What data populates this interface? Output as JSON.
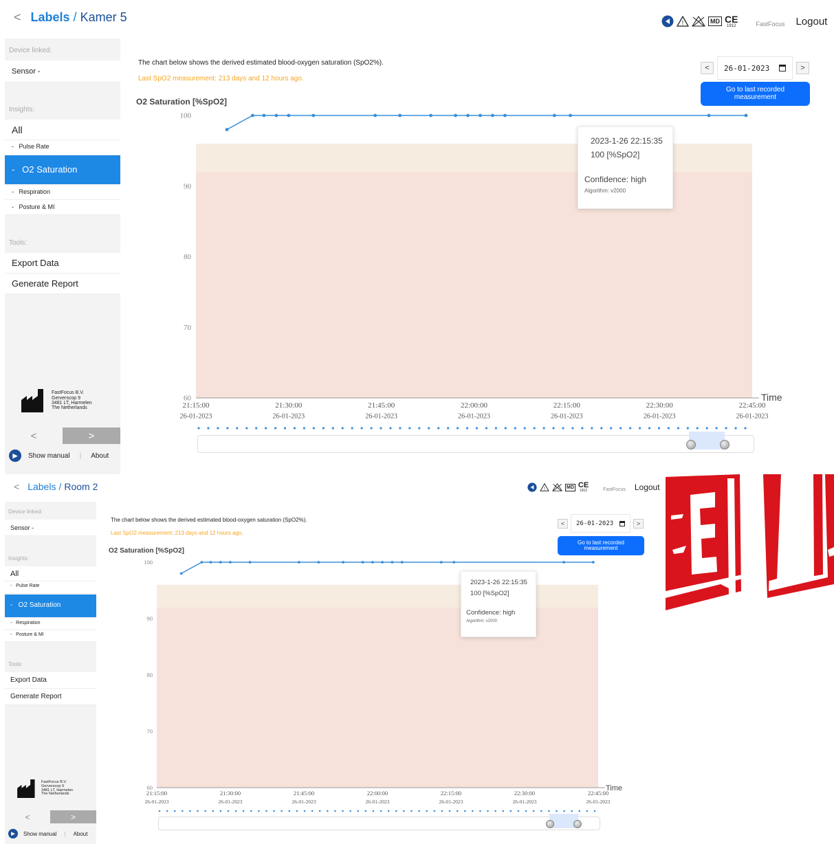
{
  "screens": [
    {
      "breadcrumb": {
        "back": "<",
        "labels_link": "Labels",
        "separator": "/",
        "room": "Kamer 5"
      },
      "header": {
        "regulatory_icons": [
          "info-icon",
          "warning-icon",
          "no-reuse-icon",
          "md-icon",
          "ce-icon"
        ],
        "md_text": "MD",
        "ce_text": "CE",
        "ce_number": "1912",
        "brand": "FastFocus",
        "logout": "Logout"
      },
      "sidebar": {
        "device_label": "Device linked:",
        "sensor": "Sensor -",
        "insights_label": "Insights:",
        "all": "All",
        "items": [
          {
            "label": "-   Pulse Rate",
            "active": false
          },
          {
            "label": "-   O2 Saturation",
            "active": true
          },
          {
            "label": "-   Respiration",
            "active": false
          },
          {
            "label": "-   Posture & MI",
            "active": false
          }
        ],
        "tools_label": "Tools:",
        "export": "Export Data",
        "report": "Generate Report",
        "company": [
          "FastFocus B.V.",
          "Gerverscop 9",
          "3481 LT, Harmelen",
          "The Netherlands"
        ],
        "prev": "<",
        "next": ">",
        "show_manual": "Show manual",
        "separator": "|",
        "about": "About"
      },
      "main": {
        "intro": "The chart below shows the derived estimated blood-oxygen saturation (SpO2%).",
        "last_measurement": "Last SpO2 measurement: 213 days and 12 hours ago.",
        "date_prev": "<",
        "date_value": "26-01-2023",
        "date_next": ">",
        "goto_last": [
          "Go to last recorded",
          "measurement"
        ]
      },
      "tooltip": {
        "timestamp": "2023-1-26 22:15:35",
        "value": "100 [%SpO2]",
        "confidence": "Confidence: high",
        "algorithm": "Algorithm: v2000"
      }
    },
    {
      "breadcrumb": {
        "back": "<",
        "labels_link": "Labels",
        "separator": "/",
        "room": "Room 2"
      },
      "header": {
        "regulatory_icons": [
          "info-icon",
          "warning-icon",
          "no-reuse-icon",
          "md-icon",
          "ce-icon"
        ],
        "md_text": "MD",
        "ce_text": "CE",
        "ce_number": "1912",
        "brand": "FastFocus",
        "logout": "Logout"
      },
      "sidebar": {
        "device_label": "Device linked:",
        "sensor": "Sensor -",
        "insights_label": "Insights:",
        "all": "All",
        "items": [
          {
            "label": "-   Pulse Rate",
            "active": false
          },
          {
            "label": "-   O2 Saturation",
            "active": true
          },
          {
            "label": "-   Respiration",
            "active": false
          },
          {
            "label": "-   Posture & MI",
            "active": false
          }
        ],
        "tools_label": "Tools:",
        "export": "Export Data",
        "report": "Generate Report",
        "company": [
          "FastFocus B.V.",
          "Gerverscop 9",
          "3481 LT, Harmelen",
          "The Netherlands"
        ],
        "prev": "<",
        "next": ">",
        "show_manual": "Show manual",
        "separator": "|",
        "about": "About"
      },
      "main": {
        "intro": "The chart below shows the derived estimated blood-oxygen saturation (SpO2%).",
        "last_measurement": "Last SpO2 measurement: 213 days and 12 hours ago.",
        "date_prev": "<",
        "date_value": "26-01-2023",
        "date_next": ">",
        "goto_last": [
          "Go to last recorded",
          "measurement"
        ]
      },
      "tooltip": {
        "timestamp": "2023-1-26 22:15:35",
        "value": "100 [%SpO2]",
        "confidence": "Confidence: high",
        "algorithm": "Algorithm: v2000"
      }
    }
  ],
  "colors": {
    "accent": "#1e88e5",
    "button": "#0d6efd",
    "warning_text": "#f5a623",
    "line": "#3b8fd9",
    "band_high": "#f7ece0",
    "band_low": "#f6e2da",
    "stamp": "#d9141c"
  },
  "chart_data": [
    {
      "type": "line",
      "title": "O2 Saturation [%SpO2]",
      "xlabel": "Time",
      "ylabel": "",
      "ylim": [
        60,
        100
      ],
      "yticks": [
        100,
        90,
        80,
        70,
        60
      ],
      "xticks": [
        {
          "time": "21:15:00",
          "date": "26-01-2023"
        },
        {
          "time": "21:30:00",
          "date": "26-01-2023"
        },
        {
          "time": "21:45:00",
          "date": "26-01-2023"
        },
        {
          "time": "22:00:00",
          "date": "26-01-2023"
        },
        {
          "time": "22:15:00",
          "date": "26-01-2023"
        },
        {
          "time": "22:30:00",
          "date": "26-01-2023"
        },
        {
          "time": "22:45:00",
          "date": "26-01-2023"
        }
      ],
      "xlim": [
        "21:15:00",
        "22:45:00"
      ],
      "bands": [
        {
          "from": 92,
          "to": 96,
          "color": "#f7ece0"
        },
        {
          "from": 60,
          "to": 92,
          "color": "#f6e2da"
        }
      ],
      "series": [
        {
          "x": [
            "21:20:00",
            "21:24:10",
            "21:26:00",
            "21:28:00",
            "21:30:00",
            "21:34:00",
            "21:44:00",
            "21:48:00",
            "21:53:00",
            "21:57:00",
            "21:59:00",
            "22:01:00",
            "22:03:00",
            "22:05:00",
            "22:13:00",
            "22:15:35",
            "22:38:00",
            "22:44:00"
          ],
          "y": [
            98,
            100,
            100,
            100,
            100,
            100,
            100,
            100,
            100,
            100,
            100,
            100,
            100,
            100,
            100,
            100,
            100,
            100
          ]
        }
      ]
    },
    {
      "type": "line",
      "title": "O2 Saturation [%SpO2]",
      "xlabel": "Time",
      "ylabel": "",
      "ylim": [
        60,
        100
      ],
      "yticks": [
        100,
        90,
        80,
        70,
        60
      ],
      "xticks": [
        {
          "time": "21:15:00",
          "date": "26-01-2023"
        },
        {
          "time": "21:30:00",
          "date": "26-01-2023"
        },
        {
          "time": "21:45:00",
          "date": "26-01-2023"
        },
        {
          "time": "22:00:00",
          "date": "26-01-2023"
        },
        {
          "time": "22:15:00",
          "date": "26-01-2023"
        },
        {
          "time": "22:30:00",
          "date": "26-01-2023"
        },
        {
          "time": "22:45:00",
          "date": "26-01-2023"
        }
      ],
      "xlim": [
        "21:15:00",
        "22:45:00"
      ],
      "bands": [
        {
          "from": 92,
          "to": 96,
          "color": "#f7ece0"
        },
        {
          "from": 60,
          "to": 92,
          "color": "#f6e2da"
        }
      ],
      "series": [
        {
          "x": [
            "21:20:00",
            "21:24:10",
            "21:26:00",
            "21:28:00",
            "21:30:00",
            "21:34:00",
            "21:44:00",
            "21:48:00",
            "21:53:00",
            "21:57:00",
            "21:59:00",
            "22:01:00",
            "22:03:00",
            "22:05:00",
            "22:13:00",
            "22:15:35",
            "22:38:00",
            "22:44:00"
          ],
          "y": [
            98,
            100,
            100,
            100,
            100,
            100,
            100,
            100,
            100,
            100,
            100,
            100,
            100,
            100,
            100,
            100,
            100,
            100
          ]
        }
      ]
    }
  ]
}
